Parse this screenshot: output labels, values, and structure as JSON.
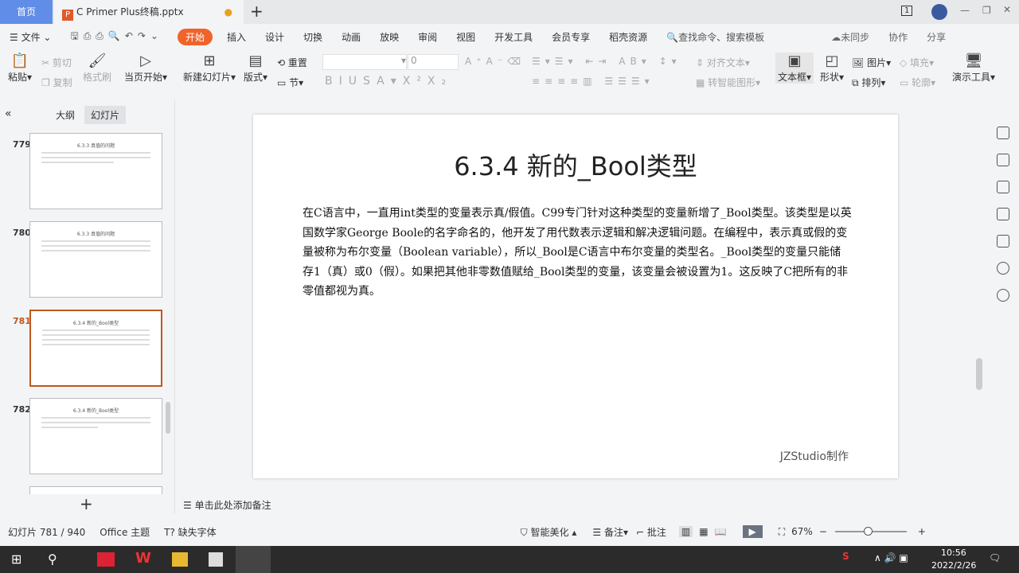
{
  "tabs": {
    "home": "首页",
    "document": "C Primer  Plus终稿.pptx",
    "new_tab": "+"
  },
  "window": {
    "badge": "1"
  },
  "menu": {
    "file": "文件",
    "items": [
      "开始",
      "插入",
      "设计",
      "切换",
      "动画",
      "放映",
      "审阅",
      "视图",
      "开发工具",
      "会员专享",
      "稻壳资源"
    ],
    "search": "查找命令、搜索模板",
    "sync": "未同步",
    "collab": "协作",
    "share": "分享"
  },
  "toolbar": {
    "paste": "粘贴",
    "cut": "剪切",
    "copy": "复制",
    "format_painter": "格式刷",
    "play_from_current": "当页开始",
    "new_slide": "新建幻灯片",
    "layout": "版式",
    "section": "节",
    "reset": "重置",
    "font_size": "0",
    "align_text": "对齐文本",
    "smart_shape": "转智能图形",
    "textbox": "文本框",
    "shape": "形状",
    "picture": "图片",
    "fill": "填充",
    "arrange": "排列",
    "outline": "轮廓",
    "presentation_tools": "演示工具"
  },
  "panel": {
    "tab_outline": "大纲",
    "tab_slides": "幻灯片",
    "thumbs": [
      {
        "num": "779",
        "title": "6.3.3 真值的问题"
      },
      {
        "num": "780",
        "title": "6.3.3 真值的问题"
      },
      {
        "num": "781",
        "title": "6.3.4 新的_Bool类型"
      },
      {
        "num": "782",
        "title": "6.3.4 新的_Bool类型"
      }
    ],
    "add": "+"
  },
  "slide": {
    "title": "6.3.4 新的_Bool类型",
    "body": "在C语言中，一直用int类型的变量表示真/假值。C99专门针对这种类型的变量新增了_Bool类型。该类型是以英国数学家George Boole的名字命名的，他开发了用代数表示逻辑和解决逻辑问题。在编程中，表示真或假的变量被称为布尔变量（Boolean variable），所以_Bool是C语言中布尔变量的类型名。_Bool类型的变量只能储存1（真）或0（假）。如果把其他非零数值赋给_Bool类型的变量，该变量会被设置为1。这反映了C把所有的非零值都视为真。",
    "credit": "JZStudio制作"
  },
  "notes": {
    "placeholder": "单击此处添加备注"
  },
  "status": {
    "slide_count": "幻灯片 781 / 940",
    "theme": "Office 主题",
    "missing_font": "缺失字体",
    "beautify": "智能美化",
    "notes": "备注",
    "comments": "批注",
    "zoom": "67%"
  },
  "taskbar": {
    "time": "10:56",
    "date": "2022/2/26"
  }
}
